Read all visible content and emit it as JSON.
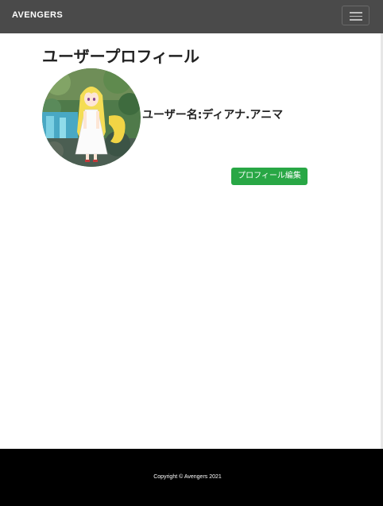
{
  "navbar": {
    "brand": "AVENGERS",
    "toggle_icon": "hamburger-menu-icon"
  },
  "profile": {
    "title": "ユーザープロフィール",
    "avatar_description": "anime-character-avatar",
    "username": "ユーザー名:ディアナ.アニマ",
    "edit_button_label": "プロフィール編集"
  },
  "footer": {
    "copyright": "Copyright © Avengers 2021"
  },
  "colors": {
    "navbar_bg": "#4a4a4a",
    "button_green": "#28a745",
    "footer_bg": "#000000"
  }
}
